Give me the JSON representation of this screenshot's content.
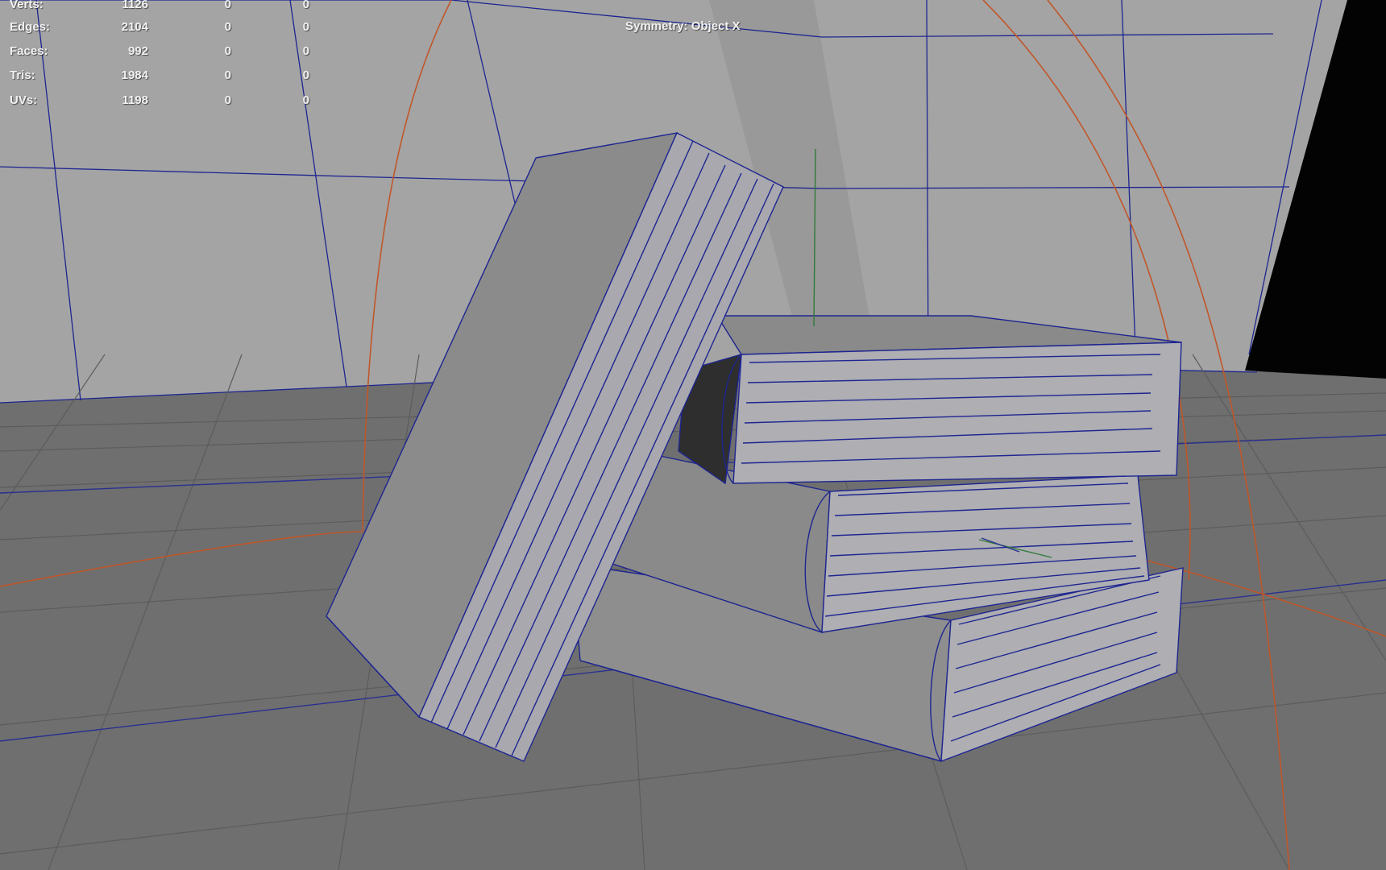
{
  "hud": {
    "stats": [
      {
        "label": "Verts:",
        "value": "1126",
        "col2": "0",
        "col3": "0"
      },
      {
        "label": "Edges:",
        "value": "2104",
        "col2": "0",
        "col3": "0"
      },
      {
        "label": "Faces:",
        "value": "992",
        "col2": "0",
        "col3": "0"
      },
      {
        "label": "Tris:",
        "value": "1984",
        "col2": "0",
        "col3": "0"
      },
      {
        "label": "UVs:",
        "value": "1198",
        "col2": "0",
        "col3": "0"
      }
    ],
    "symmetry": "Symmetry: Object X"
  },
  "colors": {
    "wall": "#a3a3a3",
    "floor": "#6e6e6e",
    "wireframe": "#1e2590",
    "light_guide": "#c0572a",
    "book_body": "#9c9c9c",
    "book_pages": "#aeaeb3",
    "dark_panel": "#000000"
  }
}
